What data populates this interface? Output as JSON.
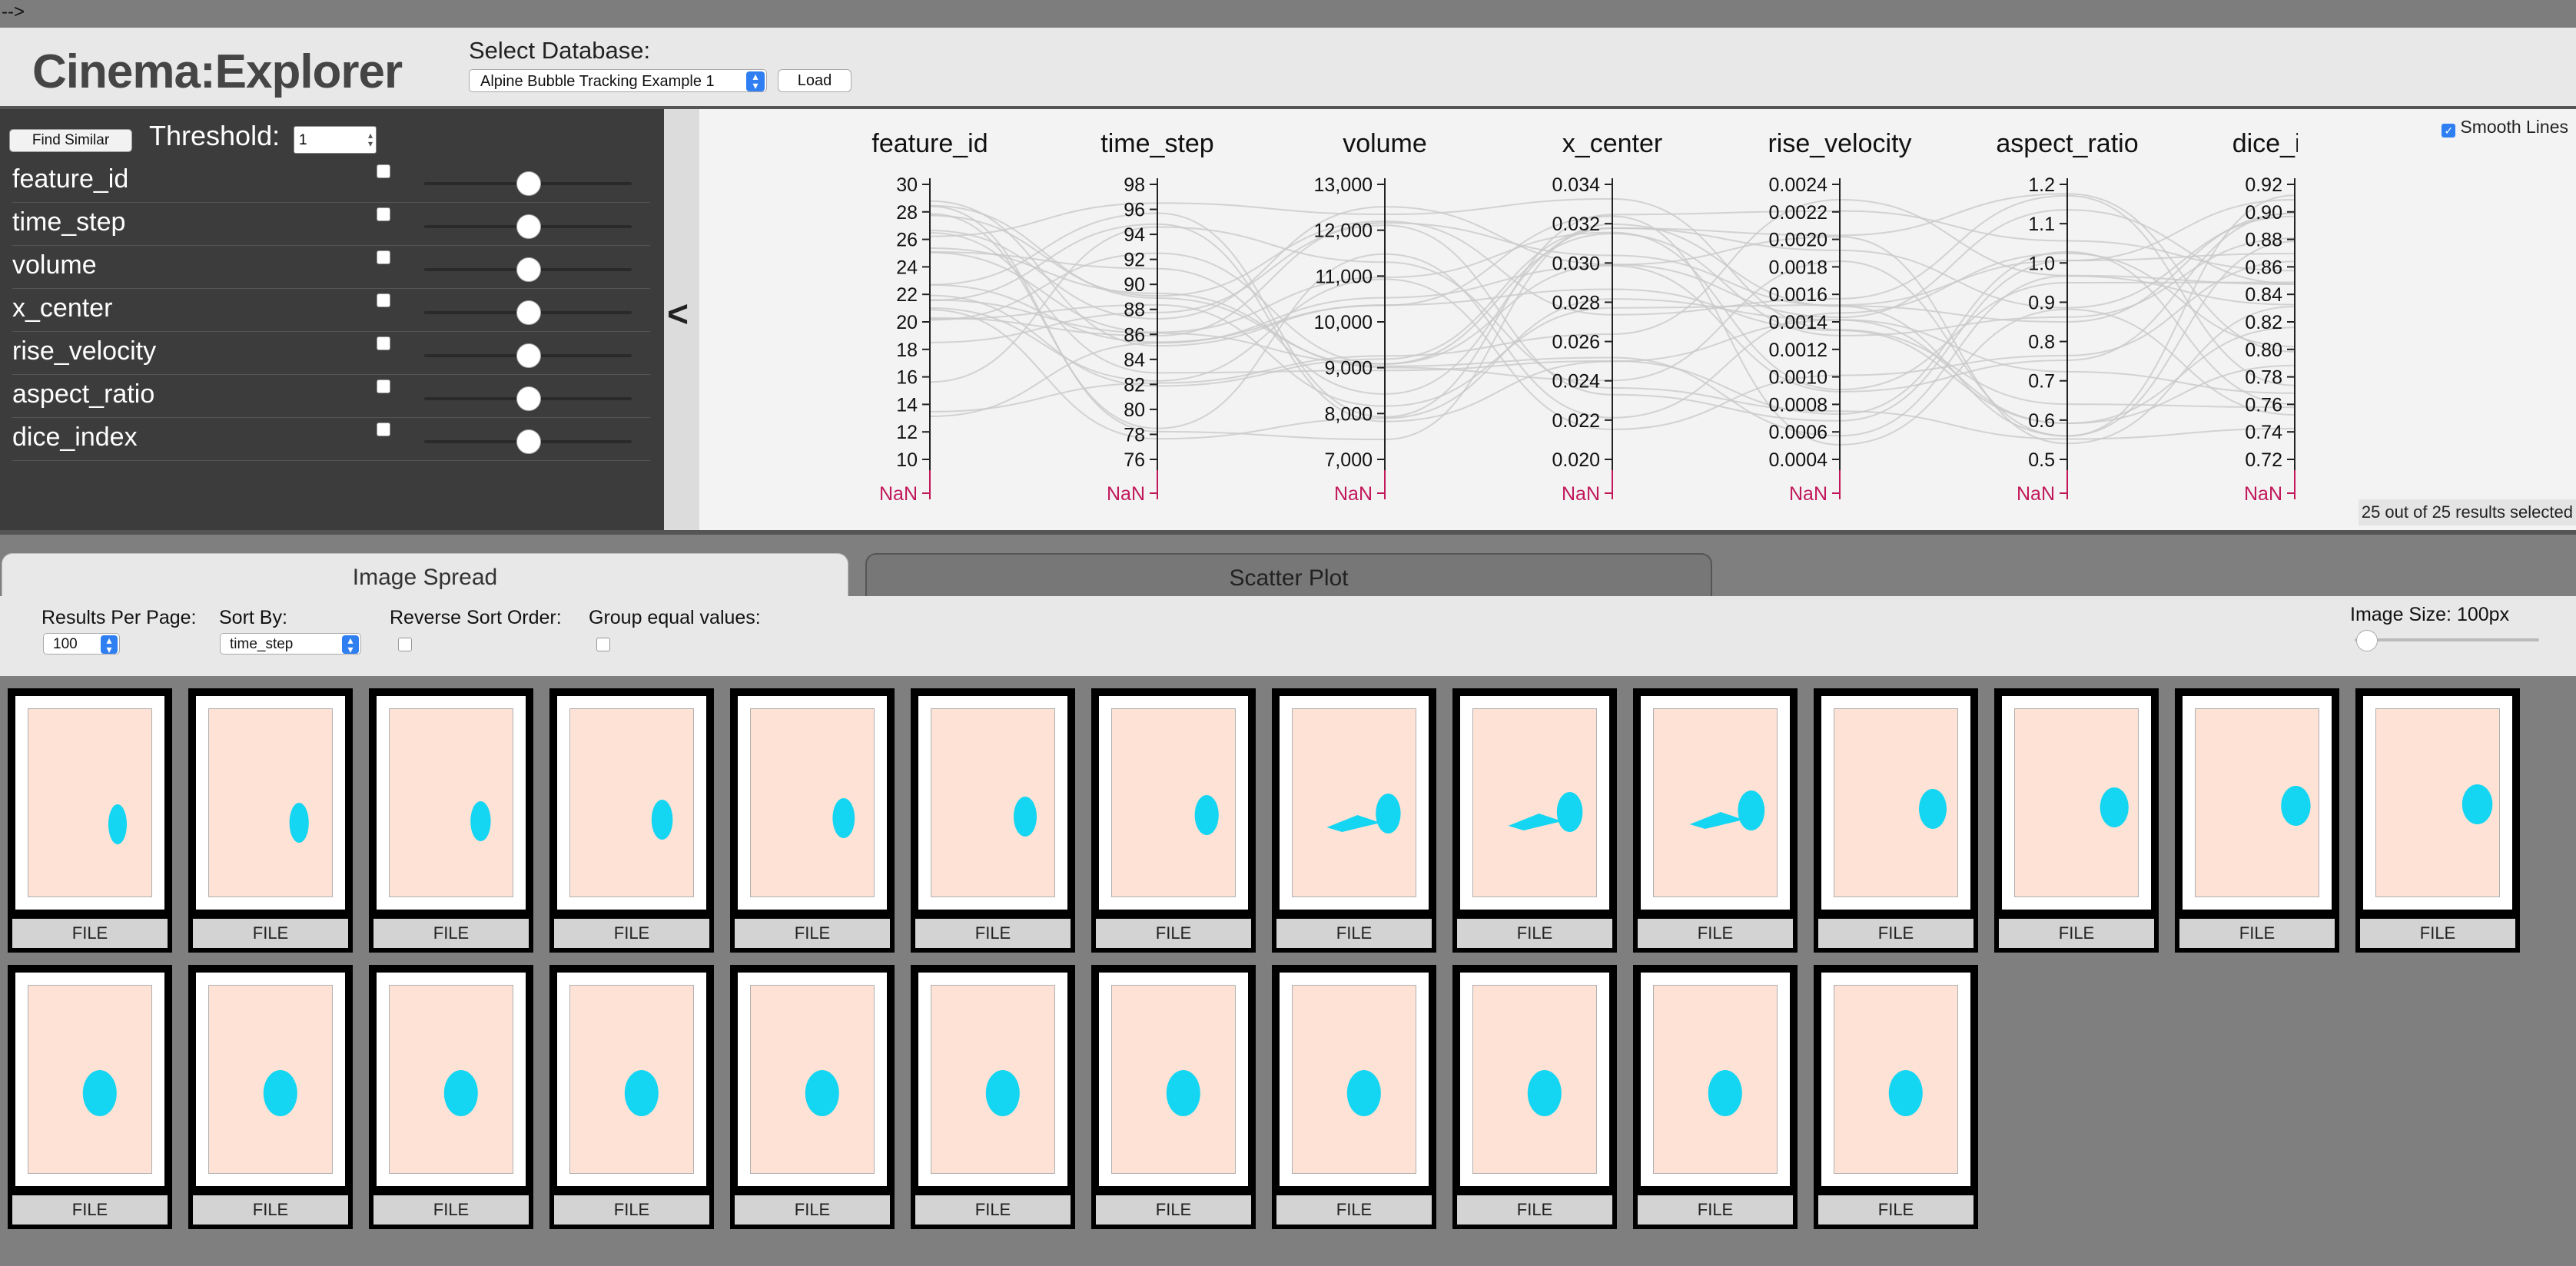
{
  "comment_text": "-->",
  "header": {
    "title": "Cinema:Explorer",
    "db_label": "Select Database:",
    "db_selected": "Alpine Bubble Tracking Example 1",
    "load_label": "Load"
  },
  "query": {
    "find_similar_label": "Find Similar",
    "threshold_label": "Threshold:",
    "threshold_value": "1",
    "features": [
      "feature_id",
      "time_step",
      "volume",
      "x_center",
      "rise_velocity",
      "aspect_ratio",
      "dice_index"
    ]
  },
  "collapse_label": "<",
  "pcoords": {
    "smooth_lines_label": "Smooth Lines",
    "selection_text": "25 out of 25 results selected",
    "nan_label": "NaN",
    "axes": [
      {
        "name": "feature_id",
        "ticks": [
          "30",
          "28",
          "26",
          "24",
          "22",
          "20",
          "18",
          "16",
          "14",
          "12",
          "10"
        ]
      },
      {
        "name": "time_step",
        "ticks": [
          "98",
          "96",
          "94",
          "92",
          "90",
          "88",
          "86",
          "84",
          "82",
          "80",
          "78",
          "76"
        ]
      },
      {
        "name": "volume",
        "ticks": [
          "13,000",
          "12,000",
          "11,000",
          "10,000",
          "9,000",
          "8,000",
          "7,000"
        ]
      },
      {
        "name": "x_center",
        "ticks": [
          "0.034",
          "0.032",
          "0.030",
          "0.028",
          "0.026",
          "0.024",
          "0.022",
          "0.020"
        ]
      },
      {
        "name": "rise_velocity",
        "ticks": [
          "0.0024",
          "0.0022",
          "0.0020",
          "0.0018",
          "0.0016",
          "0.0014",
          "0.0012",
          "0.0010",
          "0.0008",
          "0.0006",
          "0.0004"
        ]
      },
      {
        "name": "aspect_ratio",
        "ticks": [
          "1.2",
          "1.1",
          "1.0",
          "0.9",
          "0.8",
          "0.7",
          "0.6",
          "0.5"
        ]
      },
      {
        "name": "dice_index",
        "ticks": [
          "0.92",
          "0.90",
          "0.88",
          "0.86",
          "0.84",
          "0.82",
          "0.80",
          "0.78",
          "0.76",
          "0.74",
          "0.72"
        ]
      }
    ]
  },
  "tabs": [
    "Image Spread",
    "Scatter Plot"
  ],
  "controls": {
    "results_per_page_label": "Results Per Page:",
    "results_per_page_value": "100",
    "sort_by_label": "Sort By:",
    "sort_by_value": "time_step",
    "reverse_label": "Reverse Sort Order:",
    "group_label": "Group equal values:",
    "image_size_label": "Image Size: 100px"
  },
  "results": {
    "file_label": "FILE",
    "count": 25
  },
  "colors": {
    "bubble": "#14d6f2",
    "image_bg": "#fde2d5",
    "nan": "#c2185b",
    "accent": "#2f7ff2"
  }
}
